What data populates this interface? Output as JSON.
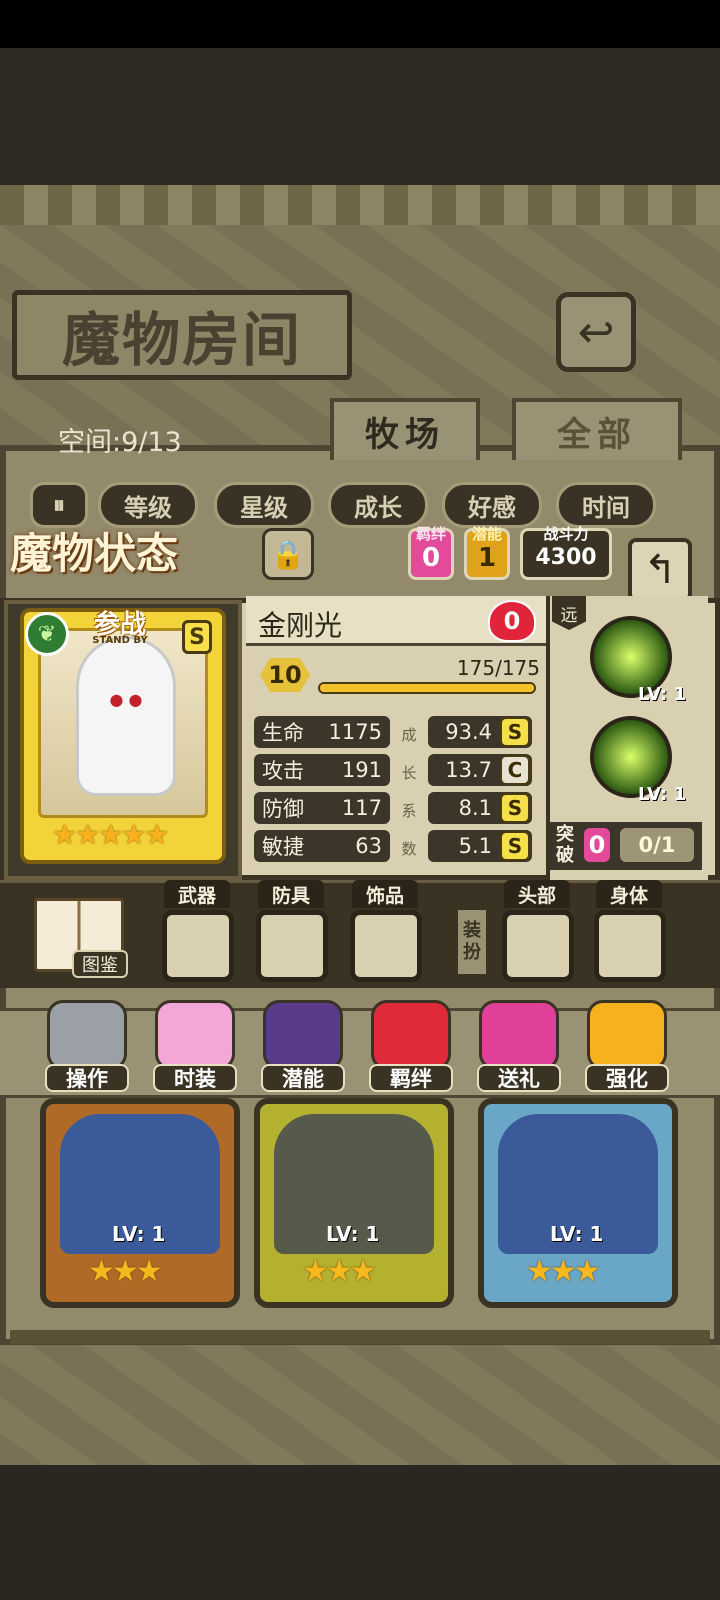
{
  "room": {
    "title": "魔物房间",
    "space_label": "空间:9/13",
    "tabs": [
      "牧场",
      "全部"
    ]
  },
  "sort": {
    "buttons": [
      "等级",
      "星级",
      "成长",
      "好感",
      "时间"
    ]
  },
  "status": {
    "title": "魔物状态",
    "bond": {
      "label": "羁绊",
      "value": "0"
    },
    "potential": {
      "label": "潜能",
      "value": "1"
    },
    "power": {
      "label": "战斗力",
      "value": "4300"
    }
  },
  "monster": {
    "name": "金刚光",
    "affection": "0",
    "standby": "参战",
    "standby_en": "STAND BY",
    "rank": "S",
    "level": "10",
    "exp": "175/175",
    "exp_fraction": 1.0,
    "stars": "★★★★★",
    "stats": [
      {
        "label": "生命",
        "value": "1175",
        "growth": "93.4",
        "grade": "S"
      },
      {
        "label": "攻击",
        "value": "191",
        "growth": "13.7",
        "grade": "C"
      },
      {
        "label": "防御",
        "value": "117",
        "growth": "8.1",
        "grade": "S"
      },
      {
        "label": "敏捷",
        "value": "63",
        "growth": "5.1",
        "grade": "S"
      }
    ],
    "growth_label_chars": [
      "成",
      "长",
      "系",
      "数"
    ]
  },
  "skills": {
    "range": "远",
    "list": [
      {
        "level": "LV: 1"
      },
      {
        "level": "LV: 1"
      }
    ],
    "break_label": "突破",
    "break_value": "0",
    "break_progress": "0/1"
  },
  "equipment": {
    "book_label": "图鉴",
    "slots": [
      "武器",
      "防具",
      "饰品"
    ],
    "dress_label": [
      "装",
      "扮"
    ],
    "dress_slots": [
      "头部",
      "身体"
    ]
  },
  "actions": [
    "操作",
    "时装",
    "潜能",
    "羁绊",
    "送礼",
    "强化"
  ],
  "roster": [
    {
      "level": "LV: 1",
      "stars": "★★★"
    },
    {
      "level": "LV: 1",
      "stars": "★★★"
    },
    {
      "level": "LV: 1",
      "stars": "★★★"
    }
  ],
  "colors": {
    "panel": "#938a6b",
    "dark": "#3a3324",
    "gold": "#f2d43a",
    "heart": "#e0243a",
    "skill_glow": "#d9ff6a"
  }
}
